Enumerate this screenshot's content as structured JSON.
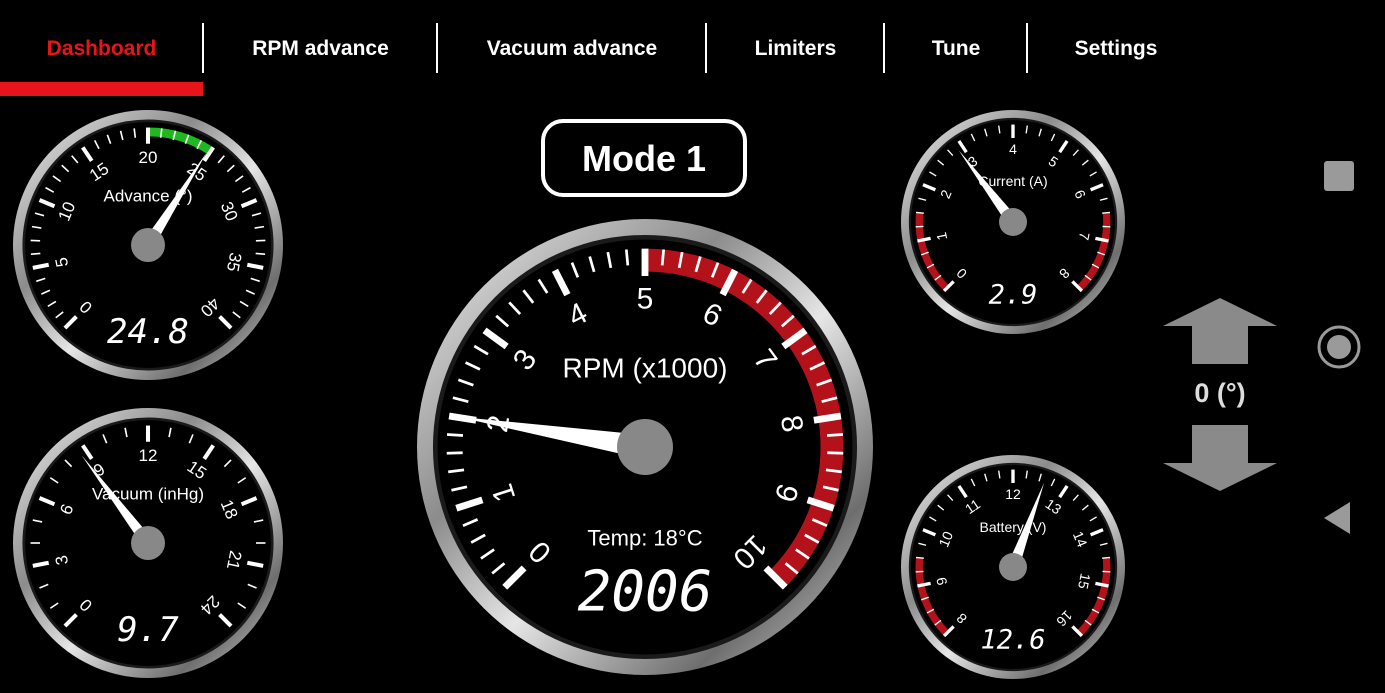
{
  "tabs": [
    {
      "label": "Dashboard",
      "active": true
    },
    {
      "label": "RPM advance",
      "active": false
    },
    {
      "label": "Vacuum advance",
      "active": false
    },
    {
      "label": "Limiters",
      "active": false
    },
    {
      "label": "Tune",
      "active": false
    },
    {
      "label": "Settings",
      "active": false
    }
  ],
  "mode": {
    "label": "Mode 1"
  },
  "advance_control": {
    "value_label": "0 (°)",
    "up_icon": "arrow-up-icon",
    "down_icon": "arrow-down-icon"
  },
  "gauges": {
    "advance": {
      "title": "Advance (°)",
      "ticks": [
        "0",
        "5",
        "10",
        "15",
        "20",
        "25",
        "30",
        "35",
        "40"
      ],
      "value": 24.8,
      "readout": "24.8",
      "min": 0,
      "max": 40,
      "green_from": 20,
      "green_to": 25
    },
    "vacuum": {
      "title": "Vacuum (inHg)",
      "ticks": [
        "0",
        "3",
        "6",
        "9",
        "12",
        "15",
        "18",
        "21",
        "24"
      ],
      "value": 8.7,
      "readout": "9.7",
      "min": 0,
      "max": 24
    },
    "rpm": {
      "title": "RPM (x1000)",
      "ticks": [
        "0",
        "1",
        "2",
        "3",
        "4",
        "5",
        "6",
        "7",
        "8",
        "9",
        "10"
      ],
      "value": 2.006,
      "readout": "2006",
      "min": 0,
      "max": 10,
      "red_from": 5,
      "temp": "Temp: 18°C"
    },
    "current": {
      "title": "Current (A)",
      "ticks": [
        "0",
        "1",
        "2",
        "3",
        "4",
        "5",
        "6",
        "7",
        "8"
      ],
      "value": 2.9,
      "readout": "2.9",
      "min": 0,
      "max": 8,
      "red_low_to": 1.5,
      "red_high_from": 6.5
    },
    "battery": {
      "title": "Battery (V)",
      "ticks": [
        "8",
        "9",
        "10",
        "11",
        "12",
        "13",
        "14",
        "15",
        "16"
      ],
      "value": 12.6,
      "readout": "12.6",
      "min": 8,
      "max": 16,
      "red_low_to": 9.5,
      "red_high_from": 14.5
    }
  },
  "colors": {
    "accent": "#e8141c",
    "warning_red": "#b3121a",
    "green_zone": "#1fb81f",
    "needle": "#ffffff",
    "hub": "#888888",
    "bezel": "#c9c9c9"
  },
  "nav": {
    "recents_icon": "square-icon",
    "home_icon": "circle-icon",
    "back_icon": "triangle-back-icon"
  }
}
